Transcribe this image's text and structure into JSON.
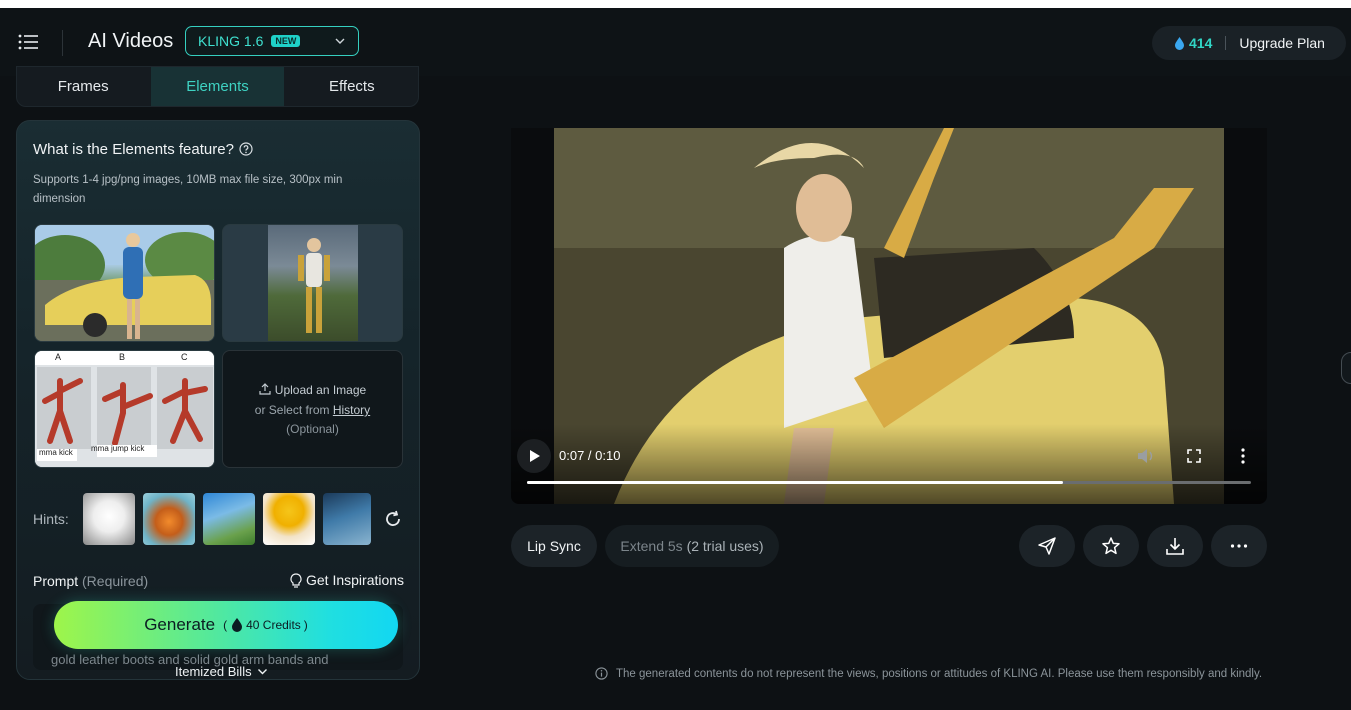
{
  "header": {
    "app_title": "AI Videos",
    "model": {
      "name": "KLING 1.6",
      "badge": "NEW"
    },
    "credits": "414",
    "upgrade_label": "Upgrade Plan"
  },
  "tabs": [
    {
      "label": "Frames",
      "active": false
    },
    {
      "label": "Elements",
      "active": true
    },
    {
      "label": "Effects",
      "active": false
    }
  ],
  "elements": {
    "question": "What is the Elements feature?",
    "description": "Supports 1-4 jpg/png images, 10MB max file size, 300px min dimension",
    "reference_labels": [
      "A",
      "B",
      "C"
    ],
    "reference_captions": [
      "mma kick",
      "mma jump kick"
    ],
    "upload": {
      "line1": "Upload an Image",
      "line2_prefix": "or Select from",
      "history_link": "History",
      "line3": "(Optional)"
    },
    "hints_label": "Hints:"
  },
  "prompt": {
    "label": "Prompt",
    "required": "(Required)",
    "inspirations": "Get Inspirations",
    "text": "gold leather boots and solid gold arm bands and"
  },
  "generate": {
    "label": "Generate",
    "open_paren": "(",
    "credits": "40 Credits",
    "close_paren": ")"
  },
  "itemized_label": "Itemized Bills",
  "video": {
    "time": "0:07 / 0:10",
    "progress": 0.74
  },
  "actions": {
    "lip_sync": "Lip Sync",
    "extend_prefix": "Extend 5s",
    "extend_trial": "(2 trial uses)"
  },
  "disclaimer": "The generated contents do not represent the views, positions or attitudes of KLING AI. Please use them responsibly and kindly.",
  "colors": {
    "accent": "#31d6c6",
    "background": "#0d1114"
  }
}
